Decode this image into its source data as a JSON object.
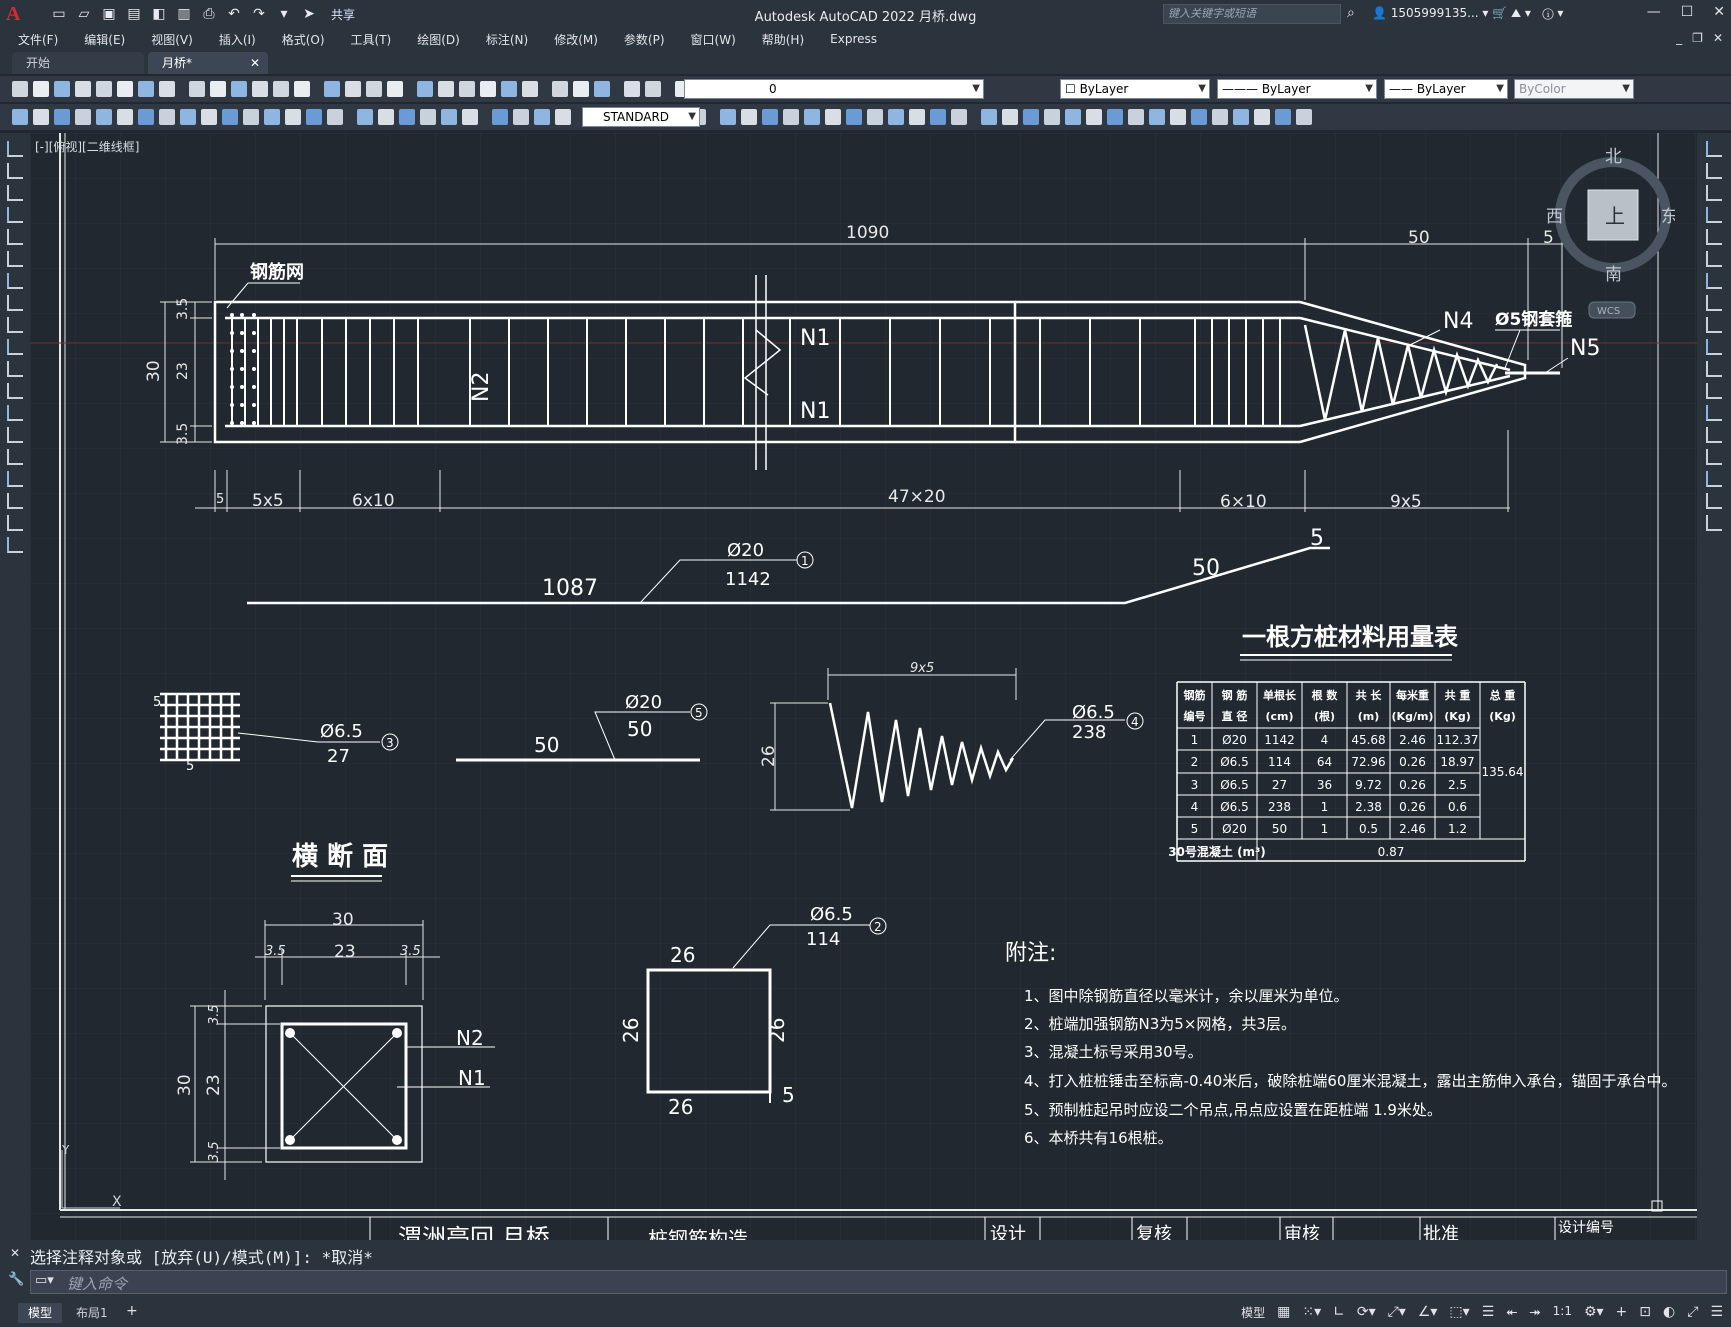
{
  "app": {
    "title": "Autodesk AutoCAD 2022    月桥.dwg",
    "share_label": "共享",
    "search_placeholder": "键入关键字或短语",
    "user": "1505999135..."
  },
  "menu": [
    "文件(F)",
    "编辑(E)",
    "视图(V)",
    "插入(I)",
    "格式(O)",
    "工具(T)",
    "绘图(D)",
    "标注(N)",
    "修改(M)",
    "参数(P)",
    "窗口(W)",
    "帮助(H)",
    "Express"
  ],
  "tabs": [
    {
      "label": "开始"
    },
    {
      "label": "月桥*"
    }
  ],
  "toolbar": {
    "layer_value": "0",
    "textstyle": "STANDARD",
    "color": "ByLayer",
    "linetype": "ByLayer",
    "lineweight": "ByLayer",
    "plotstyle": "ByColor"
  },
  "view_label": "[-][俯视][二维线框]",
  "viewcube": {
    "north": "北",
    "south": "南",
    "east": "东",
    "west": "西",
    "top": "上",
    "wcs": "WCS"
  },
  "drawing": {
    "dims_top": {
      "total": "1090",
      "taper": "50",
      "tip": "5"
    },
    "dims_left": {
      "total": "30",
      "a": "3.5",
      "b": "23",
      "c": "3.5"
    },
    "dims_bottom": [
      "5",
      "5x5",
      "6x10",
      "47×20",
      "6×10",
      "9x5"
    ],
    "labels": {
      "mesh": "钢筋网",
      "n1": "N1",
      "n2": "N2",
      "n4": "N4",
      "n5": "N5",
      "sleeve": "Ø5钢套箍"
    },
    "bar1": {
      "len_main": "1087",
      "dia": "Ø20",
      "len": "1142",
      "num": "1",
      "taper": "50",
      "tip": "5"
    },
    "bar3": {
      "dia": "Ø6.5",
      "len": "27",
      "num": "3",
      "dim": "5"
    },
    "bar5": {
      "dia": "Ø20",
      "len": "50",
      "num": "5",
      "length": "50"
    },
    "bar4": {
      "dim": "9x5",
      "height": "26",
      "dia": "Ø6.5",
      "len": "238",
      "num": "4"
    },
    "section": {
      "title": "横 断 面",
      "w": "30",
      "a": "3.5",
      "b": "23",
      "c": "3.5",
      "h": "30",
      "n2": "N2",
      "n1": "N1"
    },
    "stirrup": {
      "dia": "Ø6.5",
      "len": "114",
      "num": "2",
      "top": "26",
      "bottom": "26",
      "left": "26",
      "right": "26",
      "hook": "5"
    }
  },
  "table": {
    "title": "一根方桩材料用量表",
    "headers": [
      [
        "钢筋",
        "编号"
      ],
      [
        "钢 筋",
        "直 径"
      ],
      [
        "单根长",
        "(cm)"
      ],
      [
        "根 数",
        "(根)"
      ],
      [
        "共 长",
        "(m)"
      ],
      [
        "每米重",
        "(Kg/m)"
      ],
      [
        "共 重",
        "(Kg)"
      ],
      [
        "总 重",
        "(Kg)"
      ]
    ],
    "rows": [
      [
        "1",
        "Ø20",
        "1142",
        "4",
        "45.68",
        "2.46",
        "112.37"
      ],
      [
        "2",
        "Ø6.5",
        "114",
        "64",
        "72.96",
        "0.26",
        "18.97"
      ],
      [
        "3",
        "Ø6.5",
        "27",
        "36",
        "9.72",
        "0.26",
        "2.5"
      ],
      [
        "4",
        "Ø6.5",
        "238",
        "1",
        "2.38",
        "0.26",
        "0.6"
      ],
      [
        "5",
        "Ø20",
        "50",
        "1",
        "0.5",
        "2.46",
        "1.2"
      ]
    ],
    "total": "135.64",
    "concrete_label": "30号混凝土 (m³)",
    "concrete_value": "0.87"
  },
  "notes": {
    "title": "附注:",
    "items": [
      "1、图中除钢筋直径以毫米计，余以厘米为单位。",
      "2、桩端加强钢筋N3为5×网格，共3层。",
      "3、混凝土标号采用30号。",
      "4、打入桩桩锤击至标高-0.40米后，破除桩端60厘米混凝土，露出主筋伸入承台，锚固于承台中。",
      "5、预制桩起吊时应设二个吊点,吊点应设置在距桩端 1.9米处。",
      "6、本桥共有16根桩。"
    ]
  },
  "titleblock": [
    "渭洲亭回 月桥",
    "桩钢筋构造",
    "设计",
    "复核",
    "审核",
    "批准",
    "设计编号"
  ],
  "command": {
    "history": "选择注释对象或 [放弃(U)/模式(M)]: *取消*",
    "placeholder": "键入命令"
  },
  "status": {
    "model": "模型",
    "layout": "布局1",
    "scale": "1:1"
  }
}
